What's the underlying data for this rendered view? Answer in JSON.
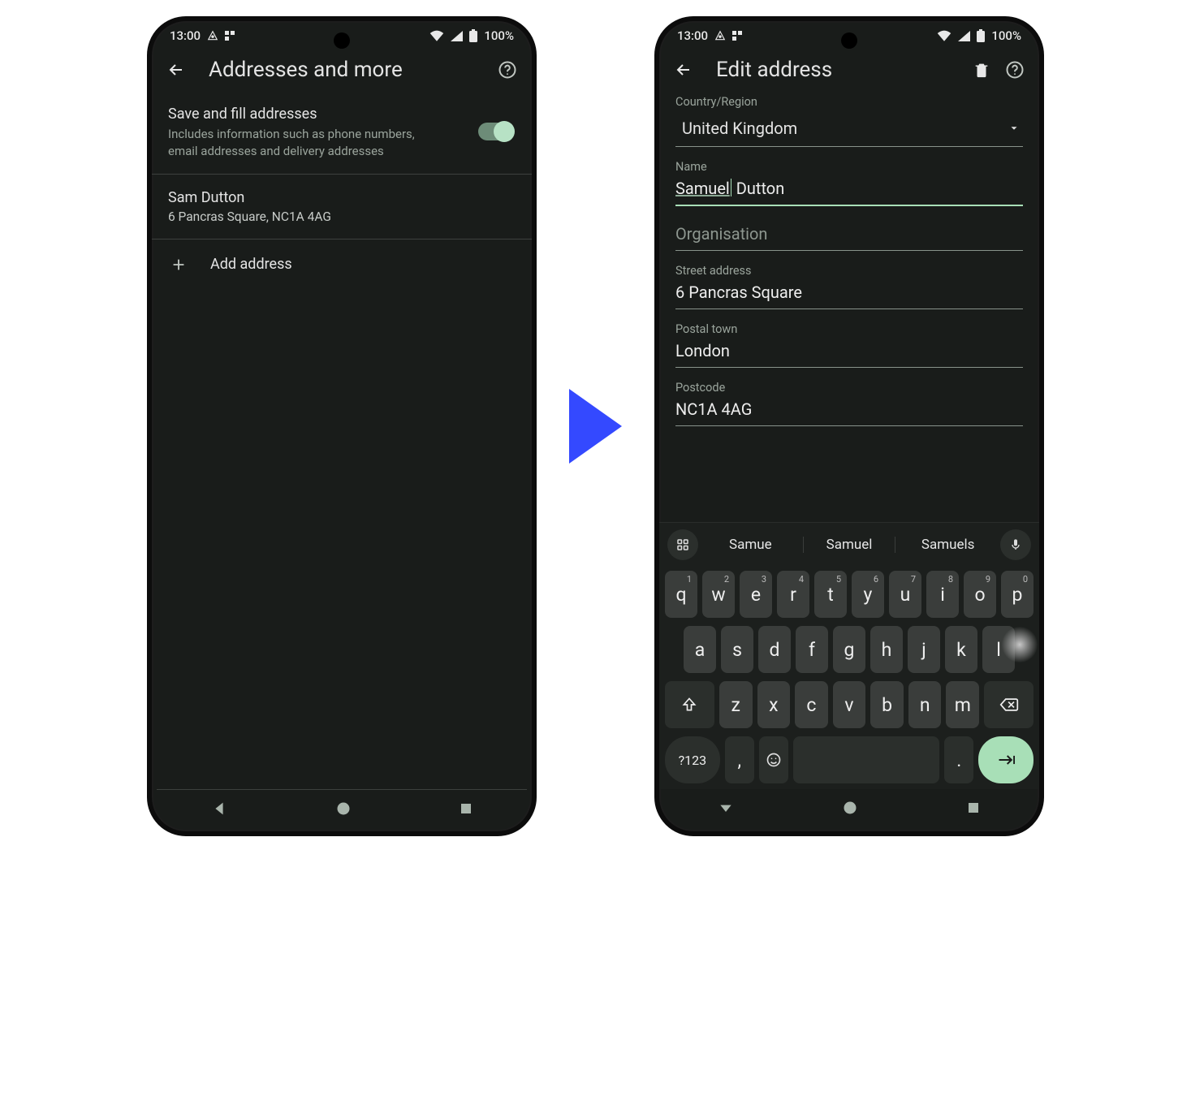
{
  "status": {
    "time": "13:00",
    "battery": "100%"
  },
  "screen1": {
    "title": "Addresses and more",
    "toggle": {
      "title": "Save and fill addresses",
      "sub": "Includes information such as phone numbers, email addresses and delivery addresses"
    },
    "saved": {
      "name": "Sam Dutton",
      "addr": "6 Pancras Square, NC1A 4AG"
    },
    "add": "Add address"
  },
  "screen2": {
    "title": "Edit address",
    "fields": {
      "country": {
        "label": "Country/Region",
        "value": "United Kingdom"
      },
      "name": {
        "label": "Name",
        "first": "Samuel",
        "last": "Dutton"
      },
      "org": {
        "label": "Organisation",
        "value": ""
      },
      "street": {
        "label": "Street address",
        "value": "6 Pancras Square"
      },
      "town": {
        "label": "Postal town",
        "value": "London"
      },
      "postcode": {
        "label": "Postcode",
        "value": "NC1A 4AG"
      }
    }
  },
  "keyboard": {
    "suggestions": [
      "Samue",
      "Samuel",
      "Samuels"
    ],
    "row1": [
      {
        "k": "q",
        "n": "1"
      },
      {
        "k": "w",
        "n": "2"
      },
      {
        "k": "e",
        "n": "3"
      },
      {
        "k": "r",
        "n": "4"
      },
      {
        "k": "t",
        "n": "5"
      },
      {
        "k": "y",
        "n": "6"
      },
      {
        "k": "u",
        "n": "7"
      },
      {
        "k": "i",
        "n": "8"
      },
      {
        "k": "o",
        "n": "9"
      },
      {
        "k": "p",
        "n": "0"
      }
    ],
    "row2": [
      "a",
      "s",
      "d",
      "f",
      "g",
      "h",
      "j",
      "k",
      "l"
    ],
    "row3": [
      "z",
      "x",
      "c",
      "v",
      "b",
      "n",
      "m"
    ],
    "symkey": "?123",
    "comma": ",",
    "period": "."
  }
}
